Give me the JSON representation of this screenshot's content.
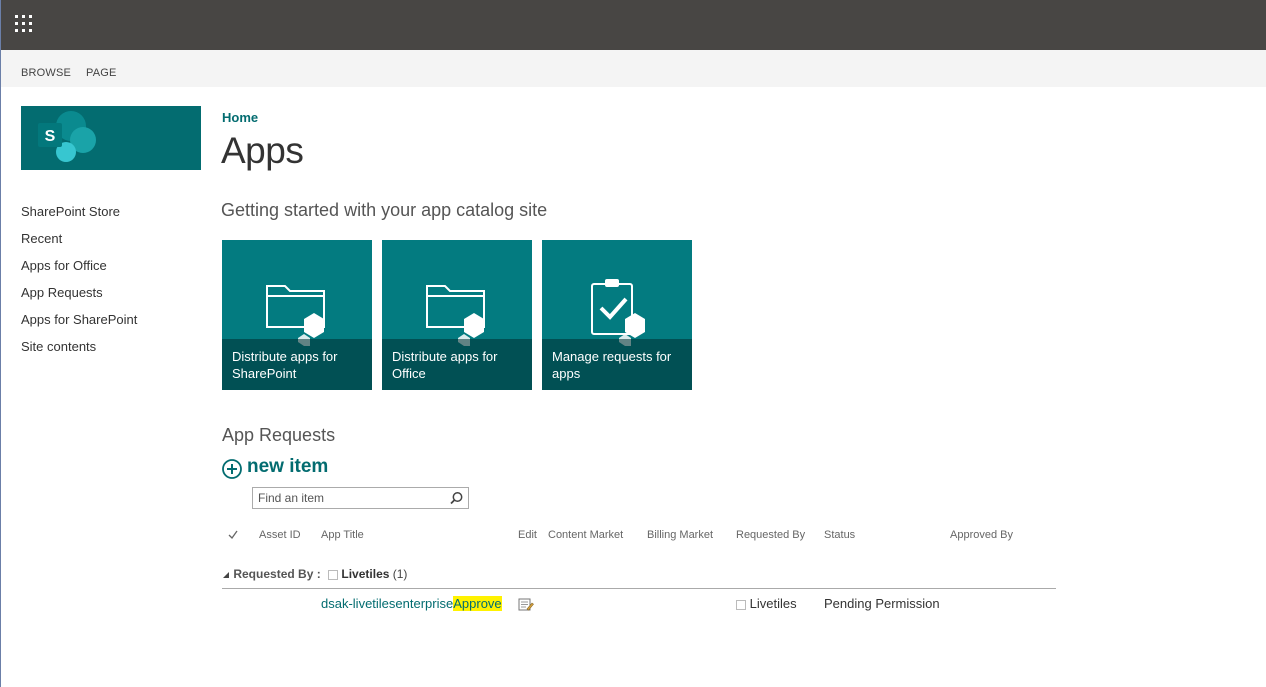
{
  "ribbon": {
    "tabs": [
      "BROWSE",
      "PAGE"
    ]
  },
  "nav": {
    "items": [
      "SharePoint Store",
      "Recent",
      "Apps for Office",
      "App Requests",
      "Apps for SharePoint",
      "Site contents"
    ]
  },
  "breadcrumb": "Home",
  "page_title": "Apps",
  "getting_started": "Getting started with your app catalog site",
  "tiles": [
    {
      "label": "Distribute apps for SharePoint",
      "icon": "folder-app-icon"
    },
    {
      "label": "Distribute apps for Office",
      "icon": "folder-app-icon"
    },
    {
      "label": "Manage requests for apps",
      "icon": "clipboard-check-icon"
    }
  ],
  "app_requests": {
    "title": "App Requests",
    "new_item_label": "new item",
    "search_placeholder": "Find an item",
    "columns": [
      "Asset ID",
      "App Title",
      "Edit",
      "Content Market",
      "Billing Market",
      "Requested By",
      "Status",
      "Approved By"
    ],
    "group": {
      "label": "Requested By :",
      "value": "Livetiles",
      "count": "(1)"
    },
    "rows": [
      {
        "app_title": "dsak-livetilesenterprise",
        "action": "Approve",
        "requested_by": "Livetiles",
        "status": "Pending Permission"
      }
    ]
  },
  "colors": {
    "accent": "#036c70",
    "tile": "#037b80",
    "suitebar": "#484644",
    "highlight": "#fff200"
  }
}
